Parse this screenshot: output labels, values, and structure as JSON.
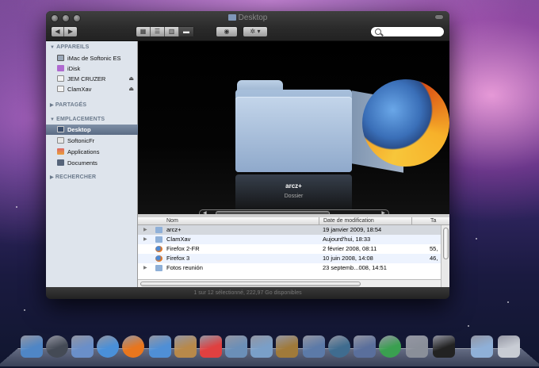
{
  "window": {
    "title": "Desktop",
    "search_placeholder": "",
    "status": "1 sur 12 sélectionné, 222,97 Go disponibles"
  },
  "sidebar": {
    "sections": [
      {
        "label": "APPAREILS"
      },
      {
        "label": "PARTAGÉS"
      },
      {
        "label": "EMPLACEMENTS"
      },
      {
        "label": "RECHERCHER"
      }
    ],
    "devices": [
      {
        "label": "iMac de Softonic ES",
        "icon": "imac-icon"
      },
      {
        "label": "iDisk",
        "icon": "idisk-icon"
      },
      {
        "label": "JEM CRUZER",
        "icon": "usb-drive-icon"
      },
      {
        "label": "ClamXav",
        "icon": "disk-image-icon"
      }
    ],
    "places": [
      {
        "label": "Desktop",
        "icon": "desktop-icon"
      },
      {
        "label": "SoftonicFr",
        "icon": "home-icon"
      },
      {
        "label": "Applications",
        "icon": "applications-icon"
      },
      {
        "label": "Documents",
        "icon": "documents-icon"
      }
    ]
  },
  "coverflow": {
    "title": "arcz+",
    "subtitle": "Dossier"
  },
  "list": {
    "columns": {
      "name": "Nom",
      "date": "Date de modification",
      "size": "Ta"
    },
    "rows": [
      {
        "name": "arcz+",
        "date": "19 janvier 2009, 18:54",
        "size": "",
        "icon": "folder-icon"
      },
      {
        "name": "ClamXav",
        "date": "Aujourd'hui, 18:33",
        "size": "",
        "icon": "folder-icon"
      },
      {
        "name": "Firefox 2-FR",
        "date": "2 février 2008, 08:11",
        "size": "55,",
        "icon": "firefox-icon"
      },
      {
        "name": "Firefox 3",
        "date": "10 juin 2008, 14:08",
        "size": "46,",
        "icon": "firefox-icon"
      },
      {
        "name": "Fotos reunión",
        "date": "23 septemb...008, 14:51",
        "size": "",
        "icon": "folder-icon"
      }
    ]
  },
  "dock": {
    "items": [
      {
        "icon": "finder-icon",
        "color": "#4f86c6"
      },
      {
        "icon": "dashboard-icon",
        "color": "#444a55"
      },
      {
        "icon": "mail-icon",
        "color": "#6a8fc9"
      },
      {
        "icon": "safari-icon",
        "color": "#4a90d9"
      },
      {
        "icon": "firefox-icon",
        "color": "#e8761e"
      },
      {
        "icon": "ichat-icon",
        "color": "#4f8fd6"
      },
      {
        "icon": "address-book-icon",
        "color": "#b8894a"
      },
      {
        "icon": "ical-icon",
        "color": "#e04040"
      },
      {
        "icon": "preview-icon",
        "color": "#6b8fb8"
      },
      {
        "icon": "iphoto-icon",
        "color": "#7a9fc8"
      },
      {
        "icon": "garageband-icon",
        "color": "#a07a3a"
      },
      {
        "icon": "spaces-icon",
        "color": "#5c7aa8"
      },
      {
        "icon": "time-machine-icon",
        "color": "#3f6c8f"
      },
      {
        "icon": "photo-booth-icon",
        "color": "#5a6f9c"
      },
      {
        "icon": "pinwheel-icon",
        "color": "#3aa050"
      },
      {
        "icon": "system-preferences-icon",
        "color": "#8a8f99"
      },
      {
        "icon": "terminal-icon",
        "color": "#222222"
      },
      {
        "icon": "folder-icon",
        "color": "#8fb0d8"
      },
      {
        "icon": "trash-icon",
        "color": "#c8ccd4"
      }
    ]
  }
}
